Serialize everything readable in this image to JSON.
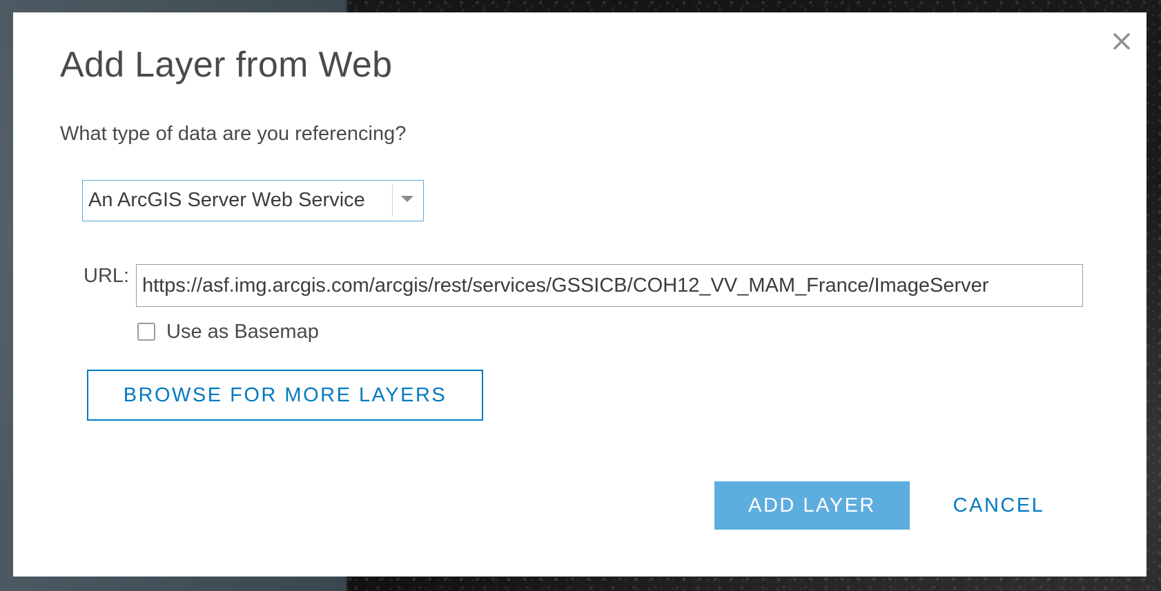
{
  "dialog": {
    "title": "Add Layer from Web",
    "question": "What type of data are you referencing?",
    "close_icon": "close-icon"
  },
  "type_select": {
    "selected": "An ArcGIS Server Web Service",
    "arrow_icon": "chevron-down-icon"
  },
  "url": {
    "label": "URL:",
    "value": "https://asf.img.arcgis.com/arcgis/rest/services/GSSICB/COH12_VV_MAM_France/ImageServer"
  },
  "basemap": {
    "label": "Use as Basemap",
    "checked": false
  },
  "buttons": {
    "browse": "BROWSE FOR MORE LAYERS",
    "add_layer": "ADD LAYER",
    "cancel": "CANCEL"
  },
  "colors": {
    "accent": "#0079c1",
    "primary_button": "#5eaddf",
    "focus_border": "#5ba8d9",
    "text": "#4a4a4a"
  }
}
